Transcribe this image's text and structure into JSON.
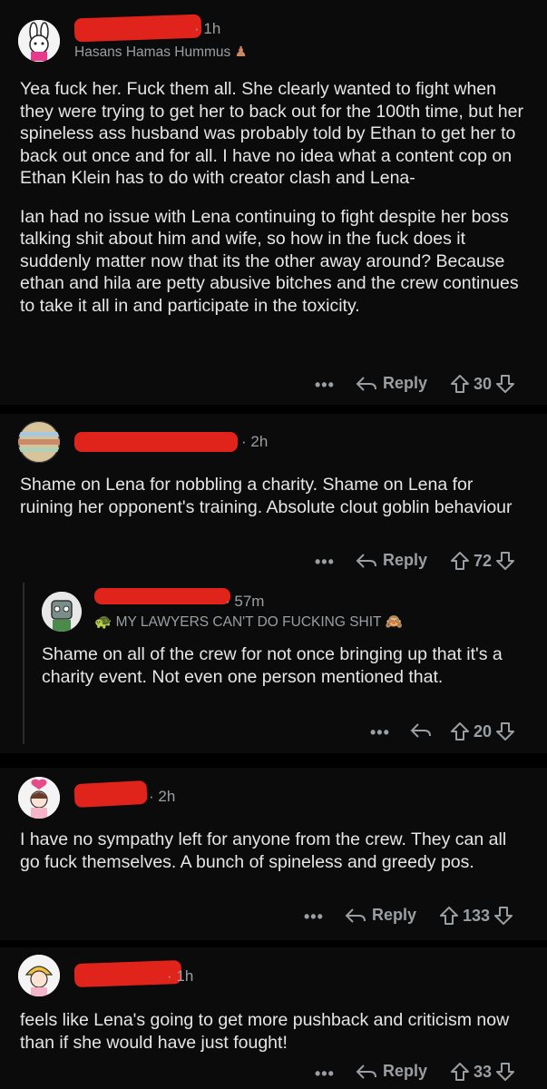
{
  "comments": [
    {
      "time": "· 1h",
      "flair": "Hasans Hamas Hummus",
      "paragraphs": [
        "Yea fuck her. Fuck them all. She clearly wanted to fight when they were trying to get her to back out for the 100th time, but her spineless ass husband was probably told by Ethan to get her to back out once and for all. I have no idea what a content cop on Ethan Klein has to do with creator clash and Lena-",
        "Ian had no issue with Lena continuing to fight despite her boss talking shit about him and wife, so how in the fuck does it suddenly matter now that its the other away around? Because ethan and hila are petty abusive bitches and the crew continues to take it all in and participate in the toxicity."
      ],
      "more": "•••",
      "reply": "Reply",
      "votes": "30"
    },
    {
      "time": "· 2h",
      "paragraphs": [
        "Shame on Lena for nobbling a charity. Shame on Lena for ruining her opponent's training. Absolute clout goblin behaviour"
      ],
      "more": "•••",
      "reply": "Reply",
      "votes": "72"
    },
    {
      "time": "· 57m",
      "flair": "MY LAWYERS CAN'T DO FUCKING SHIT",
      "paragraphs": [
        "Shame on all of the crew for not once bringing up that it's a charity event. Not even one person mentioned that."
      ],
      "more": "•••",
      "votes": "20"
    },
    {
      "time": "· 2h",
      "paragraphs": [
        "I have no sympathy left for anyone from the crew. They can all go fuck themselves. A bunch of spineless and greedy pos."
      ],
      "more": "•••",
      "reply": "Reply",
      "votes": "133"
    },
    {
      "time": "· 1h",
      "paragraphs": [
        "feels like Lena's going to get more pushback and criticism now than if she would have just fought!"
      ],
      "more": "•••",
      "reply": "Reply",
      "votes": "33"
    }
  ],
  "icons": {
    "reply": "reply-arrow-icon",
    "upvote": "upvote-arrow-icon",
    "downvote": "downvote-arrow-icon",
    "more": "more-options-icon"
  },
  "colors": {
    "background": "#000000",
    "card": "#0b0b0b",
    "redaction": "#e0231b",
    "muted_text": "#9a9fa3"
  }
}
